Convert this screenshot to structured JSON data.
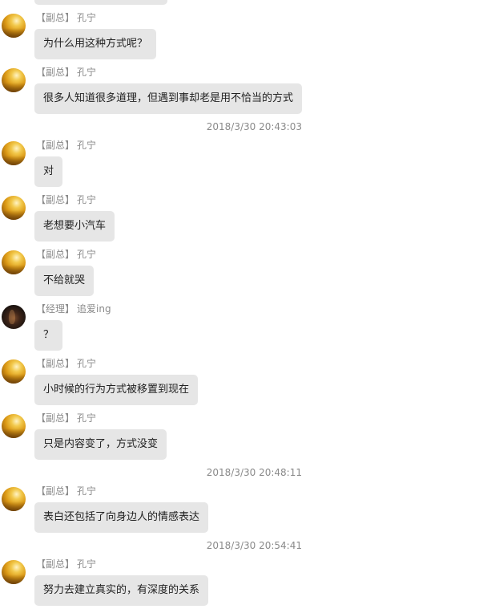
{
  "messages": [
    {
      "role": "【副总】",
      "name": "孔宁",
      "text": "为什么用这种方式呢？"
    },
    {
      "role": "【副总】",
      "name": "孔宁",
      "text": "很多人知道很多道理，但遇到事却老是用不恰当的方式"
    },
    {
      "role": "【副总】",
      "name": "孔宁",
      "text": "对"
    },
    {
      "role": "【副总】",
      "name": "孔宁",
      "text": "老想要小汽车"
    },
    {
      "role": "【副总】",
      "name": "孔宁",
      "text": "不给就哭"
    },
    {
      "role": "【经理】",
      "name": "追爱ing",
      "text": "？"
    },
    {
      "role": "【副总】",
      "name": "孔宁",
      "text": "小时候的行为方式被移置到现在"
    },
    {
      "role": "【副总】",
      "name": "孔宁",
      "text": "只是内容变了，方式没变"
    },
    {
      "role": "【副总】",
      "name": "孔宁",
      "text": "表白还包括了向身边人的情感表达"
    },
    {
      "role": "【副总】",
      "name": "孔宁",
      "text": "努力去建立真实的，有深度的关系"
    }
  ],
  "timestamps": [
    "2018/3/30 20:43:03",
    "2018/3/30 20:48:11",
    "2018/3/30 20:54:41"
  ],
  "avatars": {
    "vice_president": "yellow-car-avatar",
    "manager": "dark-portrait-avatar"
  }
}
